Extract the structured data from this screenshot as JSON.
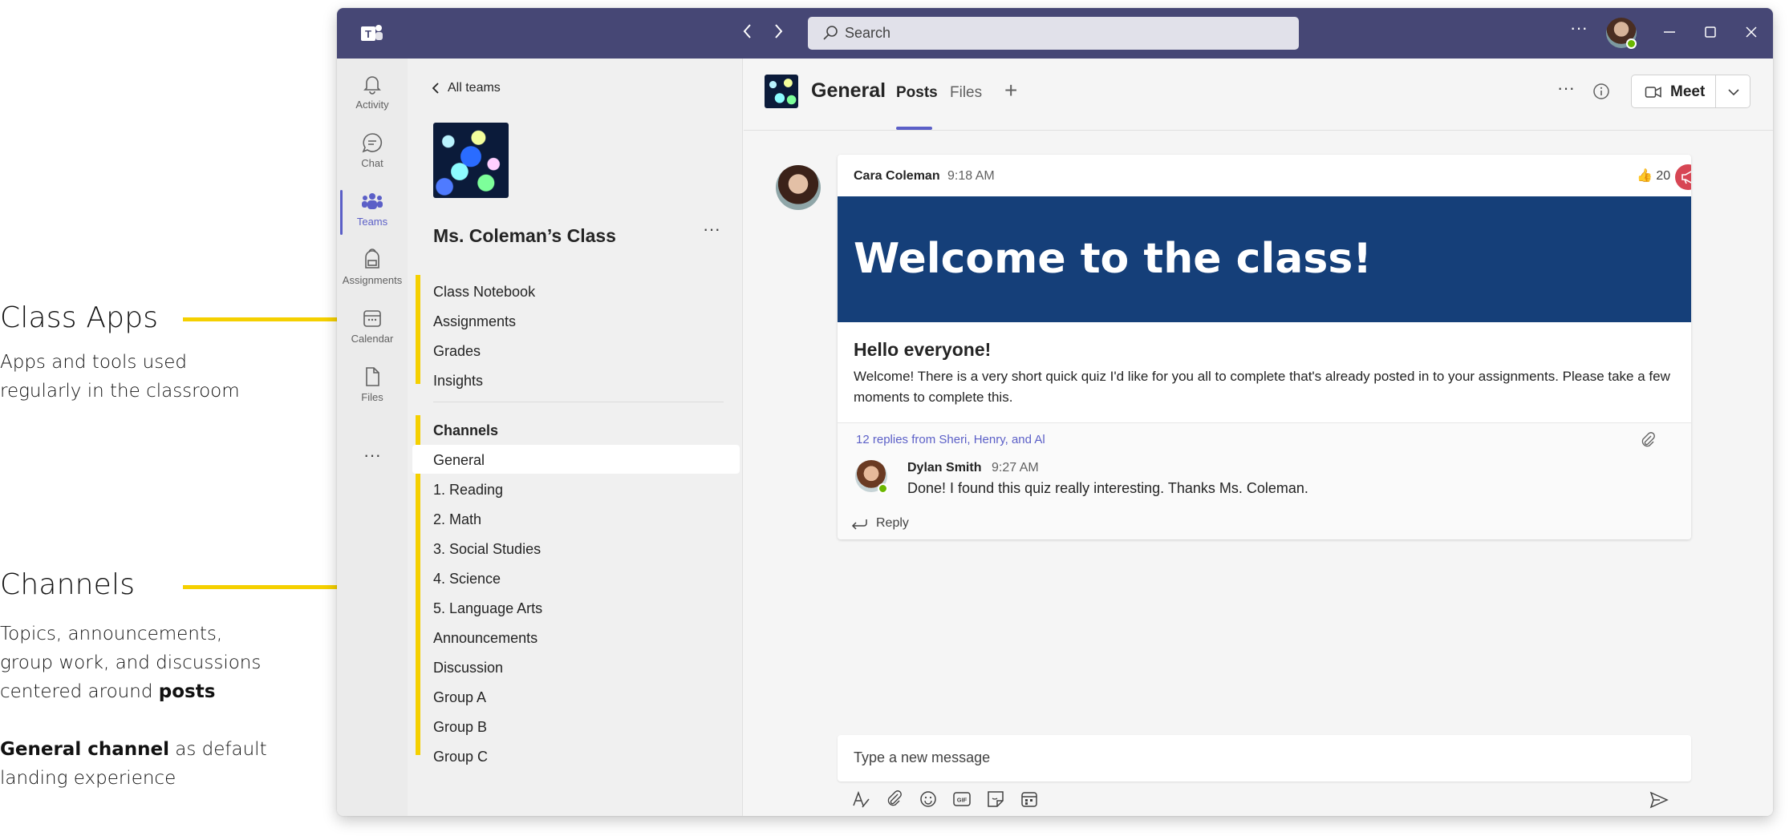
{
  "annotations": {
    "class_apps": {
      "title": "Class Apps",
      "line1": "Apps and tools used",
      "line2": "regularly in the classroom"
    },
    "channels": {
      "title": "Channels",
      "line1": "Topics, announcements,",
      "line2": "group work, and discussions",
      "line3_prefix": "centered around ",
      "line3_bold": "posts",
      "line4_bold": "General channel",
      "line4_rest": " as default",
      "line5": "landing experience"
    }
  },
  "titlebar": {
    "search_placeholder": "Search",
    "more": "···"
  },
  "rail": {
    "items": [
      {
        "label": "Activity",
        "icon": "bell-icon"
      },
      {
        "label": "Chat",
        "icon": "chat-icon"
      },
      {
        "label": "Teams",
        "icon": "teams-icon"
      },
      {
        "label": "Assignments",
        "icon": "backpack-icon"
      },
      {
        "label": "Calendar",
        "icon": "calendar-icon"
      },
      {
        "label": "Files",
        "icon": "file-icon"
      }
    ],
    "more": "···"
  },
  "panel": {
    "back_label": "All teams",
    "team_name": "Ms. Coleman’s Class",
    "more": "···",
    "apps": [
      "Class Notebook",
      "Assignments",
      "Grades",
      "Insights"
    ],
    "channels_header": "Channels",
    "channels": [
      "General",
      "1. Reading",
      "2. Math",
      "3. Social Studies",
      "4. Science",
      "5. Language Arts",
      "Announcements",
      "Discussion",
      "Group A",
      "Group B",
      "Group C"
    ]
  },
  "channel_header": {
    "title": "General",
    "tabs": [
      "Posts",
      "Files"
    ],
    "add": "+",
    "more": "···",
    "meet_label": "Meet"
  },
  "post": {
    "author": "Cara Coleman",
    "time": "9:18 AM",
    "reaction_emoji": "👍",
    "reaction_count": "20",
    "banner": "Welcome to the class!",
    "subject": "Hello everyone!",
    "body": "Welcome! There is a very short quick quiz I'd like for you all to complete that's already posted in to your assignments. Please take a few moments to complete this.",
    "replies_summary": "12 replies from Sheri, Henry, and Al",
    "reply": {
      "author": "Dylan Smith",
      "time": "9:27 AM",
      "text": "Done! I found this quiz really interesting. Thanks Ms. Coleman."
    },
    "reply_label": "Reply"
  },
  "compose": {
    "placeholder": "Type a new message"
  },
  "colors": {
    "titlebar": "#464775",
    "accent": "#5b5fc7",
    "banner": "#153f79",
    "highlight": "#f5d000"
  }
}
